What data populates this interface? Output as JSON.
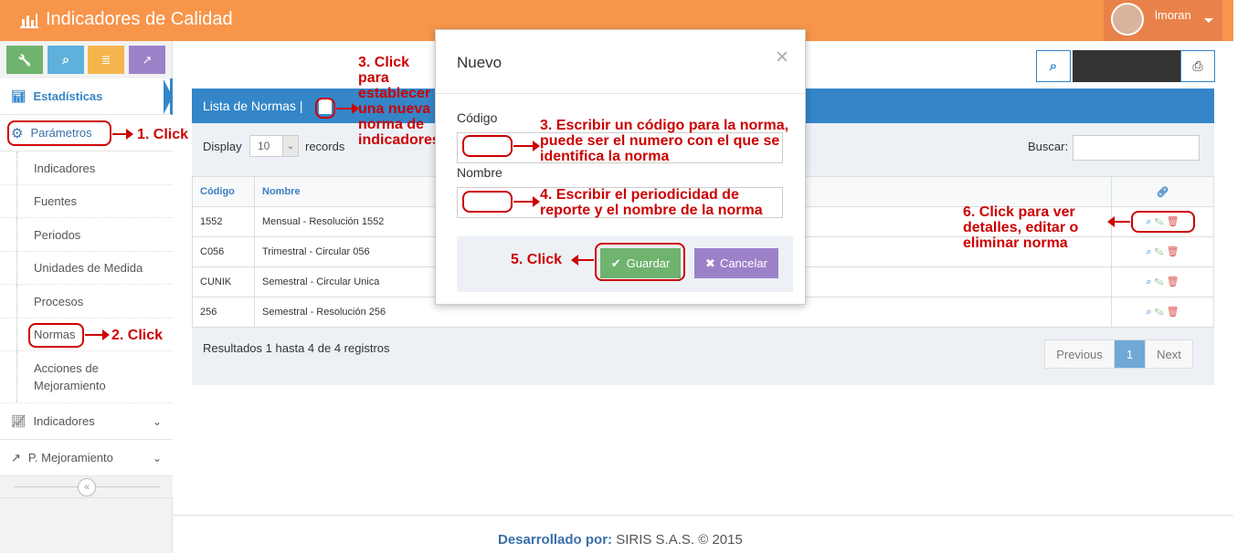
{
  "app": {
    "title": "Indicadores de Calidad",
    "user": "lmoran"
  },
  "sidebar": {
    "top_buttons": [
      {
        "icon": "wrench-icon",
        "color": "#6fb36f",
        "glyph": "🔧"
      },
      {
        "icon": "search-icon",
        "color": "#5fb1dc",
        "glyph": "🔍"
      },
      {
        "icon": "database-icon",
        "color": "#f5b54d",
        "glyph": "≣"
      },
      {
        "icon": "share-icon",
        "color": "#9b82c8",
        "glyph": "↗"
      }
    ],
    "estadisticas": "Estadísticas",
    "parametros": "Parámetros",
    "sub_items": [
      "Indicadores",
      "Fuentes",
      "Periodos",
      "Unidades de Medida",
      "Procesos",
      "Normas",
      "Acciones de Mejoramiento"
    ],
    "indicadores": "Indicadores",
    "mejoramiento": "P. Mejoramiento"
  },
  "main": {
    "panel_title": "Lista de Normas |",
    "display_label": "Display",
    "display_value": "10",
    "records_label": "records",
    "search_label": "Buscar:",
    "columns": [
      "Código",
      "Nombre"
    ],
    "rows": [
      {
        "codigo": "1552",
        "nombre": "Mensual - Resolución 1552"
      },
      {
        "codigo": "C056",
        "nombre": "Trimestral - Circular 056"
      },
      {
        "codigo": "CUNIK",
        "nombre": "Semestral - Circular Unica"
      },
      {
        "codigo": "256",
        "nombre": "Semestral - Resolución 256"
      }
    ],
    "results": "Resultados 1 hasta 4 de 4 registros",
    "pagination": {
      "previous": "Previous",
      "page": "1",
      "next": "Next"
    }
  },
  "modal": {
    "title": "Nuevo",
    "close": "×",
    "codigo_label": "Código",
    "nombre_label": "Nombre",
    "save": "Guardar",
    "cancel": "Cancelar"
  },
  "annotations": {
    "a1": "1. Click",
    "a2": "2. Click",
    "a3": [
      "3. Click",
      "para",
      "establecer",
      "una nueva",
      "norma de",
      "indicadores"
    ],
    "a3b": [
      "3. Escribir un código para la norma,",
      "puede ser el numero con el que se",
      "identifica la norma"
    ],
    "a4": [
      "4. Escribir el periodicidad de",
      "reporte y el nombre de la norma"
    ],
    "a5": "5. Click",
    "a6": [
      "6. Click para ver",
      "detalles, editar o",
      "eliminar norma"
    ]
  },
  "footer": {
    "label": "Desarrollado por:",
    "company": "SIRIS S.A.S. © 2015"
  },
  "colors": {
    "navbar": "#f7954a",
    "primary": "#3486c9",
    "success": "#6fb36f",
    "cancel": "#9b82c8",
    "annotation": "#cc0000"
  }
}
